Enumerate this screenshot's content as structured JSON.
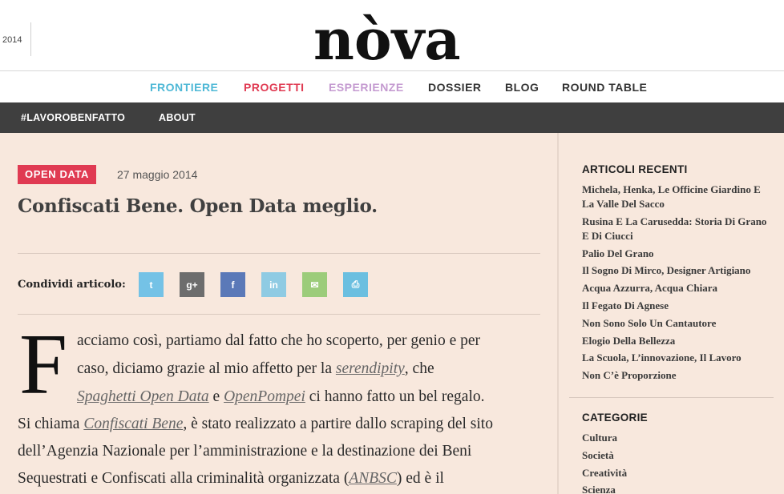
{
  "header": {
    "year": "2014",
    "logo_text": "nòva"
  },
  "main_nav": [
    {
      "label": "FRONTIERE",
      "color": "#4eb8d6"
    },
    {
      "label": "PROGETTI",
      "color": "#e03a52"
    },
    {
      "label": "ESPERIENZE",
      "color": "#c49ad0"
    },
    {
      "label": "DOSSIER",
      "color": "#333333"
    },
    {
      "label": "BLOG",
      "color": "#333333"
    },
    {
      "label": "ROUND TABLE",
      "color": "#333333"
    }
  ],
  "sub_nav": [
    {
      "label": "#LAVOROBENFATTO"
    },
    {
      "label": "ABOUT"
    }
  ],
  "article": {
    "tag": "OPEN DATA",
    "date": "27 maggio 2014",
    "title": "Confiscati Bene. Open Data meglio.",
    "share_label": "Condividi articolo:",
    "share_buttons": [
      {
        "name": "twitter",
        "glyph": "t",
        "color": "#74c2e6"
      },
      {
        "name": "google-plus",
        "glyph": "g+",
        "color": "#6d6d6d"
      },
      {
        "name": "facebook",
        "glyph": "f",
        "color": "#5b79b8"
      },
      {
        "name": "linkedin",
        "glyph": "in",
        "color": "#8fcbe3"
      },
      {
        "name": "email",
        "glyph": "✉",
        "color": "#9ccc7a"
      },
      {
        "name": "print",
        "glyph": "⎙",
        "color": "#6bbfe0"
      }
    ],
    "dropcap": "F",
    "line1": "acciamo così, partiamo dal fatto che ho scoperto, per genio e per",
    "line2_a": "caso, diciamo grazie al mio affetto per la ",
    "line2_link": "serendipity",
    "line2_b": ", che",
    "line3_link1": "Spaghetti Open Data",
    "line3_a": " e ",
    "line3_link2": "OpenPompei",
    "line3_b": " ci hanno fatto un bel regalo.",
    "line4_a": "Si chiama ",
    "line4_link": "Confiscati Bene",
    "line4_b": ", è stato realizzato a partire dallo scraping del sito",
    "line5": "dell’Agenzia Nazionale per l’amministrazione e la destinazione dei Beni",
    "line6_a": "Sequestrati e Confiscati alla criminalità organizzata (",
    "line6_link": "ANBSC",
    "line6_b": ") ed è il"
  },
  "sidebar": {
    "recent_title": "ARTICOLI RECENTI",
    "recent": [
      "Michela, Henka, Le Officine Giardino E La Valle Del Sacco",
      "Rusina E La Carusedda: Storia Di Grano E Di Ciucci",
      "Palio Del Grano",
      "Il Sogno Di Mirco, Designer Artigiano",
      "Acqua Azzurra, Acqua Chiara",
      "Il Fegato Di Agnese",
      "Non Sono Solo Un Cantautore",
      "Elogio Della Bellezza",
      "La Scuola, L’innovazione, Il Lavoro",
      "Non C’è Proporzione"
    ],
    "categories_title": "CATEGORIE",
    "categories": [
      "Cultura",
      "Società",
      "Creatività",
      "Scienza"
    ]
  }
}
